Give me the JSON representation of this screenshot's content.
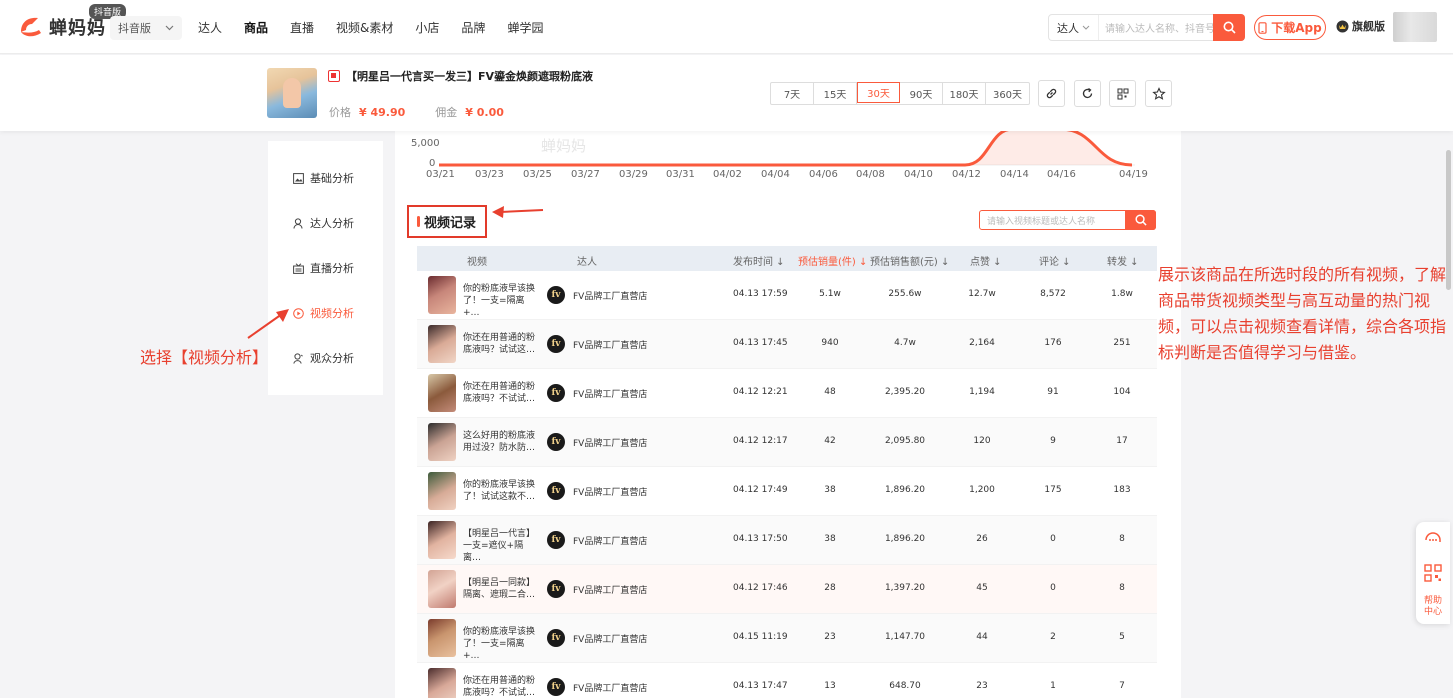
{
  "brand": {
    "name": "蝉妈妈",
    "badge": "抖音版",
    "accent": "#fa5a3c"
  },
  "platform_select": {
    "value": "抖音版"
  },
  "nav": [
    "达人",
    "商品",
    "直播",
    "视频&素材",
    "小店",
    "品牌",
    "蝉学园"
  ],
  "nav_active": "商品",
  "top_search": {
    "category": "达人",
    "placeholder": "请输入达人名称、抖音号"
  },
  "download_label": "下载App",
  "vip_label": "旗舰版",
  "product": {
    "title": "【明星吕一代言买一发三】FV鎏金焕颜遮瑕粉底液",
    "price_label": "价格",
    "price": "¥ 49.90",
    "commission_label": "佣金",
    "commission": "¥ 0.00"
  },
  "ranges": [
    "7天",
    "15天",
    "30天",
    "90天",
    "180天",
    "360天"
  ],
  "range_active": "30天",
  "header_actions": [
    "link-icon",
    "refresh-icon",
    "qrcode-icon",
    "star-icon"
  ],
  "chart_data": {
    "type": "area",
    "x": [
      "03/21",
      "03/23",
      "03/25",
      "03/27",
      "03/29",
      "03/31",
      "04/02",
      "04/04",
      "04/06",
      "04/08",
      "04/10",
      "04/12",
      "04/14",
      "04/16",
      "04/19"
    ],
    "series": [
      {
        "values": [
          0,
          0,
          0,
          0,
          0,
          0,
          0,
          0,
          0,
          0,
          0,
          0,
          9000,
          9000,
          0
        ]
      }
    ],
    "yticks": [
      "5,000",
      "0"
    ],
    "color": "#fa5a3c",
    "watermark": "蝉妈妈"
  },
  "side_menu": [
    {
      "label": "基础分析",
      "icon": "image-icon"
    },
    {
      "label": "达人分析",
      "icon": "user-icon"
    },
    {
      "label": "直播分析",
      "icon": "tv-icon"
    },
    {
      "label": "视频分析",
      "icon": "play-icon"
    },
    {
      "label": "观众分析",
      "icon": "audience-icon"
    }
  ],
  "side_active": "视频分析",
  "section": {
    "title": "视频记录",
    "search_placeholder": "请输入视频标题或达人名称"
  },
  "columns": [
    {
      "label": "视频"
    },
    {
      "label": "达人"
    },
    {
      "label": "发布时间 ↓"
    },
    {
      "label": "预估销量(件) ↓"
    },
    {
      "label": "预估销售额(元) ↓"
    },
    {
      "label": "点赞 ↓"
    },
    {
      "label": "评论 ↓"
    },
    {
      "label": "转发 ↓"
    }
  ],
  "sorted_column": "预估销量(件) ↓",
  "talent_logo": "fv",
  "rows": [
    {
      "title": "你的粉底液早该换了！一支=隔离+…",
      "talent": "FV品牌工厂直营店",
      "time": "04.13 17:59",
      "sales": "5.1w",
      "amount": "255.6w",
      "likes": "12.7w",
      "comments": "8,572",
      "shares": "1.8w"
    },
    {
      "title": "你还在用普通的粉底液吗？试试这…",
      "talent": "FV品牌工厂直营店",
      "time": "04.13 17:45",
      "sales": "940",
      "amount": "4.7w",
      "likes": "2,164",
      "comments": "176",
      "shares": "251"
    },
    {
      "title": "你还在用普通的粉底液吗？不试试…",
      "talent": "FV品牌工厂直营店",
      "time": "04.12 12:21",
      "sales": "48",
      "amount": "2,395.20",
      "likes": "1,194",
      "comments": "91",
      "shares": "104"
    },
    {
      "title": "这么好用的粉底液用过没？防水防…",
      "talent": "FV品牌工厂直营店",
      "time": "04.12 12:17",
      "sales": "42",
      "amount": "2,095.80",
      "likes": "120",
      "comments": "9",
      "shares": "17"
    },
    {
      "title": "你的粉底液早该换了！试试这款不…",
      "talent": "FV品牌工厂直营店",
      "time": "04.12 17:49",
      "sales": "38",
      "amount": "1,896.20",
      "likes": "1,200",
      "comments": "175",
      "shares": "183"
    },
    {
      "title": "【明星吕一代言】一支=遮仪+隔离…",
      "talent": "FV品牌工厂直营店",
      "time": "04.13 17:50",
      "sales": "38",
      "amount": "1,896.20",
      "likes": "26",
      "comments": "0",
      "shares": "8"
    },
    {
      "title": "【明星吕一同款】隔离、遮瑕二合…",
      "talent": "FV品牌工厂直营店",
      "time": "04.12 17:46",
      "sales": "28",
      "amount": "1,397.20",
      "likes": "45",
      "comments": "0",
      "shares": "8"
    },
    {
      "title": "你的粉底液早该换了！一支=隔离+…",
      "talent": "FV品牌工厂直营店",
      "time": "04.15 11:19",
      "sales": "23",
      "amount": "1,147.70",
      "likes": "44",
      "comments": "2",
      "shares": "5"
    },
    {
      "title": "你还在用普通的粉底液吗？不试试…",
      "talent": "FV品牌工厂直营店",
      "time": "04.13 17:47",
      "sales": "13",
      "amount": "648.70",
      "likes": "23",
      "comments": "1",
      "shares": "7"
    }
  ],
  "annotations": {
    "left": "选择【视频分析】",
    "right": "展示该商品在所选时段的所有视频，了解商品带货视频类型与高互动量的热门视频，可以点击视频查看详情，综合各项指标判断是否值得学习与借鉴。"
  },
  "help": {
    "label": "帮助中心"
  }
}
